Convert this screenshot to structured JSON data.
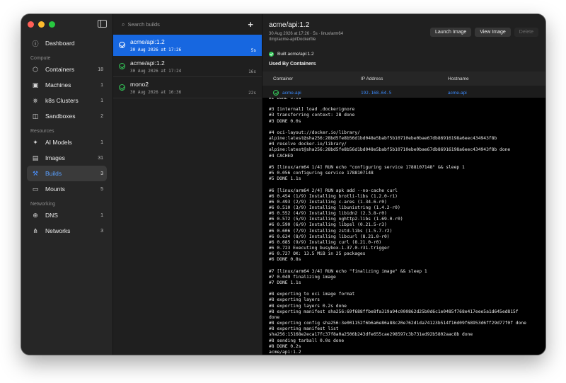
{
  "sidebar": {
    "items": [
      {
        "label": "Dashboard",
        "count": "",
        "icon": "info-circle-icon"
      },
      {
        "section": "Compute"
      },
      {
        "label": "Containers",
        "count": "18",
        "icon": "cube-icon"
      },
      {
        "label": "Machines",
        "count": "1",
        "icon": "cpu-icon"
      },
      {
        "label": "k8s Clusters",
        "count": "1",
        "icon": "helm-icon"
      },
      {
        "label": "Sandboxes",
        "count": "2",
        "icon": "box-icon"
      },
      {
        "section": "Resources"
      },
      {
        "label": "AI Models",
        "count": "1",
        "icon": "sparkle-icon"
      },
      {
        "label": "Images",
        "count": "31",
        "icon": "layers-icon"
      },
      {
        "label": "Builds",
        "count": "3",
        "icon": "hammer-icon",
        "active": true
      },
      {
        "label": "Mounts",
        "count": "5",
        "icon": "drive-icon"
      },
      {
        "section": "Networking"
      },
      {
        "label": "DNS",
        "count": "1",
        "icon": "globe-icon"
      },
      {
        "label": "Networks",
        "count": "3",
        "icon": "network-icon"
      }
    ]
  },
  "builds": {
    "search_placeholder": "Search builds",
    "items": [
      {
        "name": "acme/api:1.2",
        "date": "30 Aug 2026 at 17:26",
        "duration": "5s",
        "active": true
      },
      {
        "name": "acme/api:1.2",
        "date": "30 Aug 2026 at 17:24",
        "duration": "16s"
      },
      {
        "name": "mono2",
        "date": "30 Aug 2026 at 16:36",
        "duration": "22s"
      }
    ]
  },
  "detail": {
    "title": "acme/api:1.2",
    "meta": "30 Aug 2026 at 17:26  ·  5s  ·  linux/arm64",
    "path": "/tmp/acme-api/Dockerfile",
    "buttons": {
      "launch": "Launch Image",
      "view": "View Image",
      "delete": "Delete"
    },
    "built_label": "Built acme/api:1.2",
    "used_by": "Used By Containers",
    "table": {
      "headers": [
        "Container",
        "IP Address",
        "Hostname"
      ],
      "rows": [
        [
          "acme-api",
          "192.168.64.5",
          "acme-api"
        ]
      ]
    }
  },
  "log": [
    "#2 DONE 0.0s",
    "",
    "#3 [internal] load .dockerignore",
    "#3 transferring context: 2B done",
    "#3 DONE 0.0s",
    "",
    "#4 oci-layout://docker.io/library/",
    "alpine:latest@sha256:28bd5fe8b56d1bd048e5babf5b10710ebe0bae67db86916198a6eec434943f8b",
    "#4 resolve docker.io/library/",
    "alpine:latest@sha256:28bd5fe8b56d1bd048e5babf5b10710ebe0bae67db86916198a6eec434943f8b done",
    "#4 CACHED",
    "",
    "#5 [linux/arm64 1/4] RUN echo \"configuring service 1788107148\" && sleep 1",
    "#5 0.056 configuring service 1788107148",
    "#5 DONE 1.1s",
    "",
    "#6 [linux/arm64 2/4] RUN apk add --no-cache curl",
    "#6 0.454 (1/9) Installing brotli-libs (1.2.0-r1)",
    "#6 0.493 (2/9) Installing c-ares (1.34.6-r0)",
    "#6 0.510 (3/9) Installing libunistring (1.4.2-r0)",
    "#6 0.552 (4/9) Installing libidn2 (2.3.8-r0)",
    "#6 0.572 (5/9) Installing nghttp2-libs (1.69.0-r0)",
    "#6 0.590 (6/9) Installing libpsl (0.21.5-r3)",
    "#6 0.606 (7/9) Installing zstd-libs (1.5.7-r2)",
    "#6 0.634 (8/9) Installing libcurl (8.21.0-r0)",
    "#6 0.685 (9/9) Installing curl (8.21.0-r0)",
    "#6 0.723 Executing busybox-1.37.0-r31.trigger",
    "#6 0.727 OK: 13.5 MiB in 25 packages",
    "#6 DONE 0.8s",
    "",
    "#7 [linux/arm64 3/4] RUN echo \"finalizing image\" && sleep 1",
    "#7 0.049 finalizing image",
    "#7 DONE 1.1s",
    "",
    "#8 exporting to oci image format",
    "#8 exporting layers",
    "#8 exporting layers 0.2s done",
    "#8 exporting manifest sha256:69f688ffbe8fa319a94c000862d25b0d6c1e0485f768e417eee5a1d645ed815f",
    "done",
    "#8 exporting config sha256:3e001152f6b6a6e86a88c20e762d1da74123b514f16d09f68953d6ff29d77f0f done",
    "#8 exporting manifest list",
    "sha256:15168e2eca17fc37f8a0a2506b243dfe655cae298597c3b731ed92b5802aac8b done",
    "#8 sending tarball 0.0s done",
    "#8 DONE 0.2s",
    "acme/api:1.2"
  ]
}
